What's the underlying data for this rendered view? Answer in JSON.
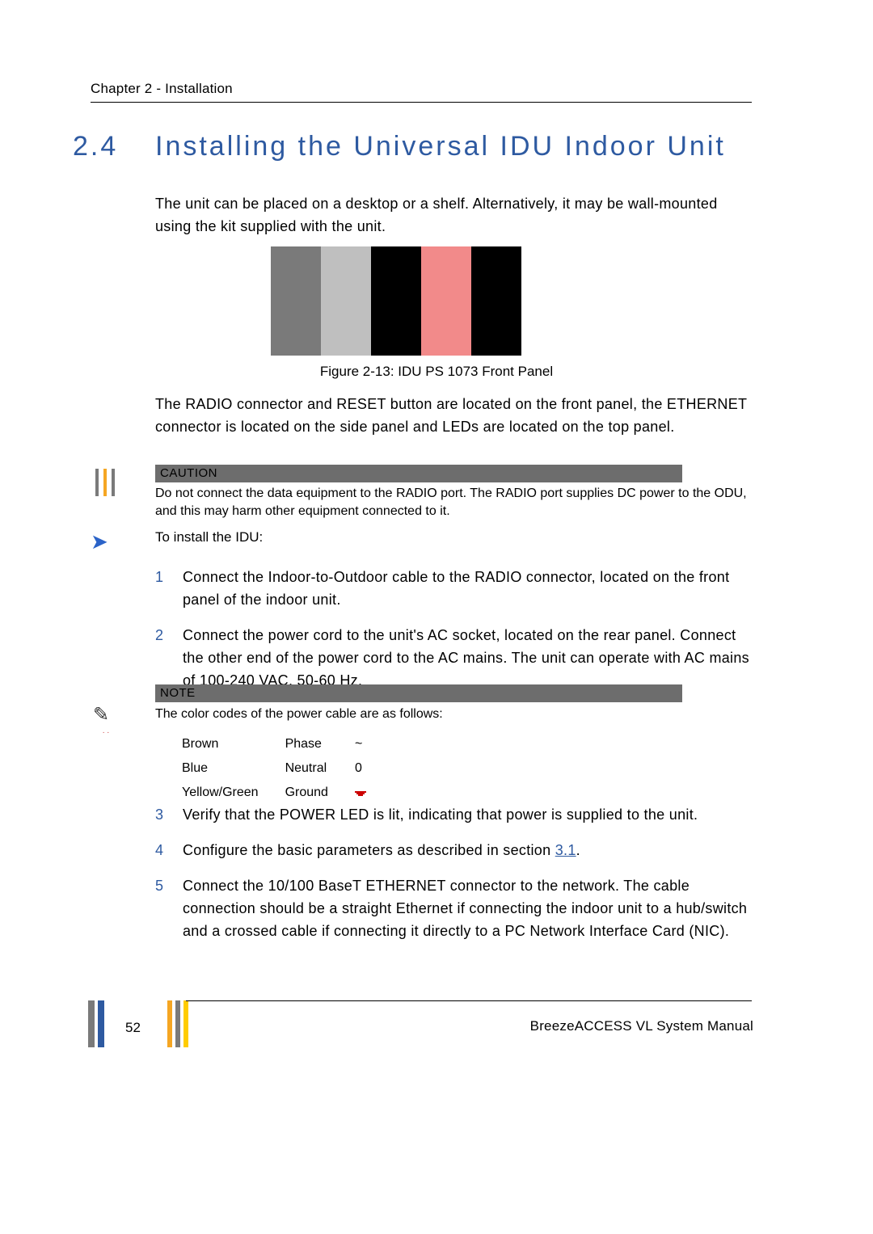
{
  "header": {
    "chapter": "Chapter 2 - Installation"
  },
  "section": {
    "number": "2.4",
    "title": "Installing the Universal IDU Indoor Unit"
  },
  "paragraphs": {
    "p1": "The unit can be placed on a desktop or a shelf. Alternatively, it may be wall-mounted using the kit supplied with the unit.",
    "figcap": "Figure 2-13: IDU PS 1073 Front Panel",
    "p2": "The RADIO connector and RESET button are located on the front panel, the ETHERNET connector is located on the side panel and LEDs are located on the top panel.",
    "caution_label": "CAUTION",
    "caution_text": "Do not connect the data equipment to the RADIO port. The RADIO port supplies DC power to the ODU, and this may harm other equipment connected to it.",
    "to_install": "To install the IDU:",
    "note_label": "NOTE",
    "note_text": "The color codes of the power cable are as follows:"
  },
  "steps_a": [
    {
      "n": "1",
      "t": "Connect the Indoor-to-Outdoor cable to the RADIO connector, located on the front panel of the indoor unit."
    },
    {
      "n": "2",
      "t": "Connect the power cord to the unit's AC socket, located on the rear panel. Connect the other end of the power cord to the AC mains. The unit can operate with AC mains of 100-240 VAC, 50-60 Hz."
    }
  ],
  "color_table": [
    {
      "color": "Brown",
      "role": "Phase",
      "sym": "~"
    },
    {
      "color": "Blue",
      "role": "Neutral",
      "sym": "0"
    },
    {
      "color": "Yellow/Green",
      "role": "Ground",
      "sym": "ground"
    }
  ],
  "steps_b": [
    {
      "n": "3",
      "t": "Verify that the POWER LED is lit, indicating that power is supplied to the unit."
    },
    {
      "n": "4",
      "t_pre": "Configure the basic parameters as described in section ",
      "link": "3.1",
      "t_post": "."
    },
    {
      "n": "5",
      "t": "Connect the 10/100 BaseT ETHERNET connector to the network. The cable connection should be a straight Ethernet if connecting the indoor unit to a hub/switch and a crossed cable if connecting it directly to a PC Network Interface Card (NIC)."
    }
  ],
  "footer": {
    "page": "52",
    "manual": "BreezeACCESS VL System Manual"
  }
}
